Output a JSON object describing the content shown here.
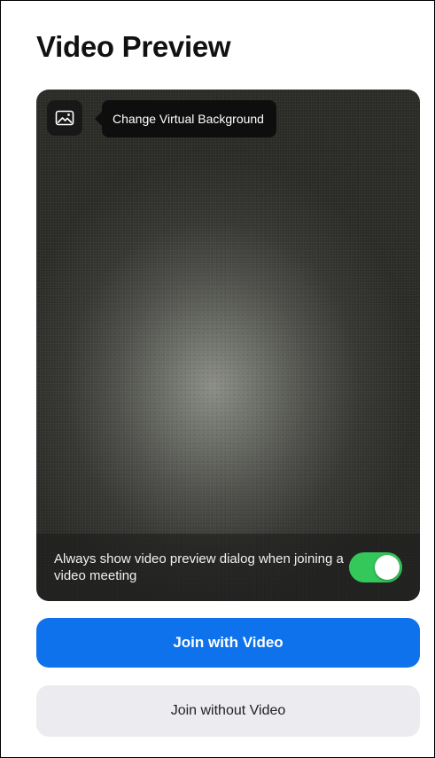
{
  "header": {
    "title": "Video Preview"
  },
  "preview": {
    "virtual_background_icon": "picture-icon",
    "tooltip": "Change Virtual Background",
    "always_show_text": "Always show video preview dialog when joining a video meeting",
    "always_show_enabled": true
  },
  "actions": {
    "join_with_video": "Join with Video",
    "join_without_video": "Join without Video"
  },
  "colors": {
    "primary": "#0e72ed",
    "toggle_on": "#34c759",
    "secondary_button": "#ececf0"
  }
}
